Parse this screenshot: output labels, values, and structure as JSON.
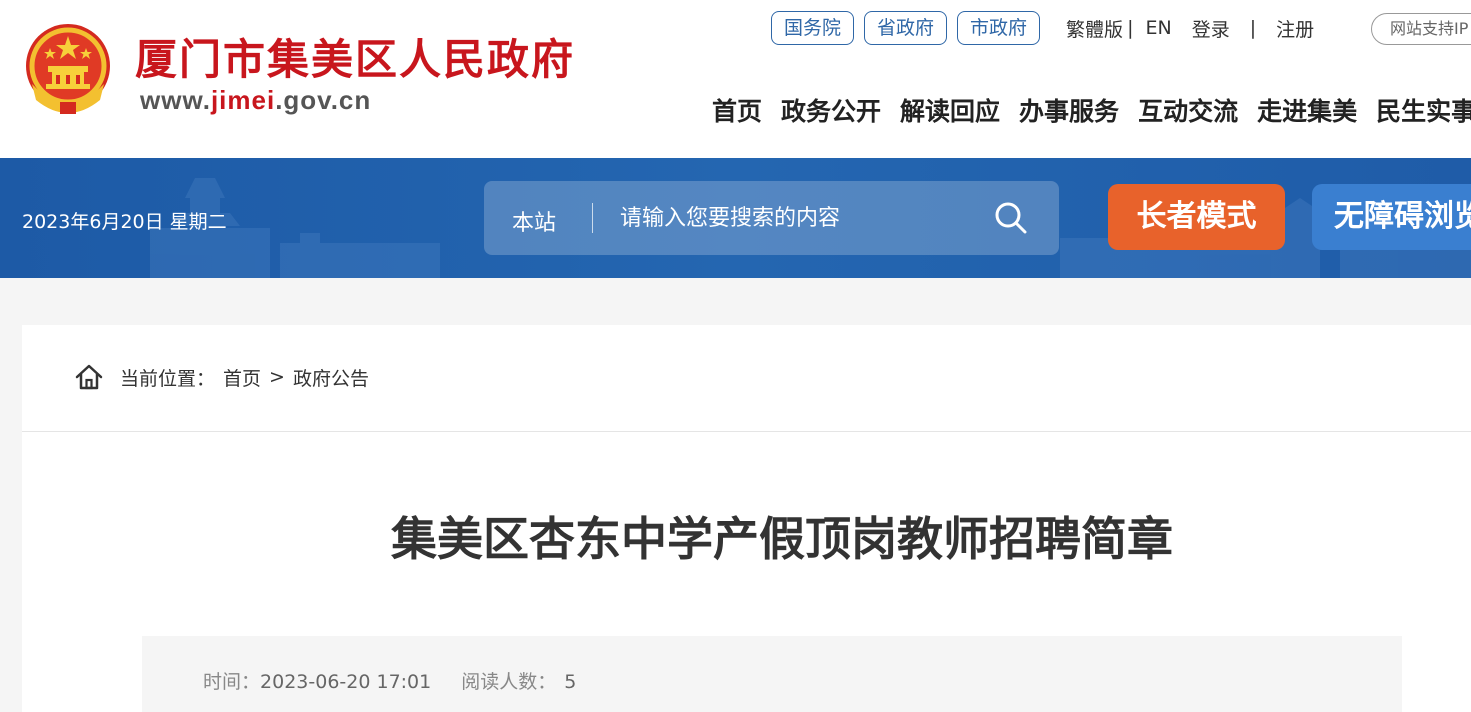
{
  "header": {
    "site_title": "厦门市集美区人民政府",
    "site_url_prefix": "www.",
    "site_url_highlight": "jimei",
    "site_url_suffix": ".gov.cn",
    "gov_links": [
      "国务院",
      "省政府",
      "市政府"
    ],
    "traditional": "繁體版",
    "english": "EN",
    "login": "登录",
    "register": "注册",
    "support": "网站支持IP",
    "nav": [
      "首页",
      "政务公开",
      "解读回应",
      "办事服务",
      "互动交流",
      "走进集美",
      "民生实事"
    ]
  },
  "banner": {
    "date": "2023年6月20日 星期二",
    "search_scope": "本站",
    "search_placeholder": "请输入您要搜索的内容",
    "elder_mode": "长者模式",
    "accessible": "无障碍浏览"
  },
  "breadcrumb": {
    "label": "当前位置：",
    "home": "首页",
    "separator": ">",
    "current": "政府公告"
  },
  "article": {
    "title": "集美区杏东中学产假顶岗教师招聘简章",
    "time_label": "时间：",
    "time_value": "2023-06-20 17:01",
    "reads_label": "阅读人数：",
    "reads_value": "5"
  },
  "colors": {
    "brand_red": "#c8161d",
    "banner_blue": "#1d5aa6",
    "elder_orange": "#e8622b",
    "access_blue": "#3a7fd0",
    "link_blue": "#2f67a7"
  }
}
